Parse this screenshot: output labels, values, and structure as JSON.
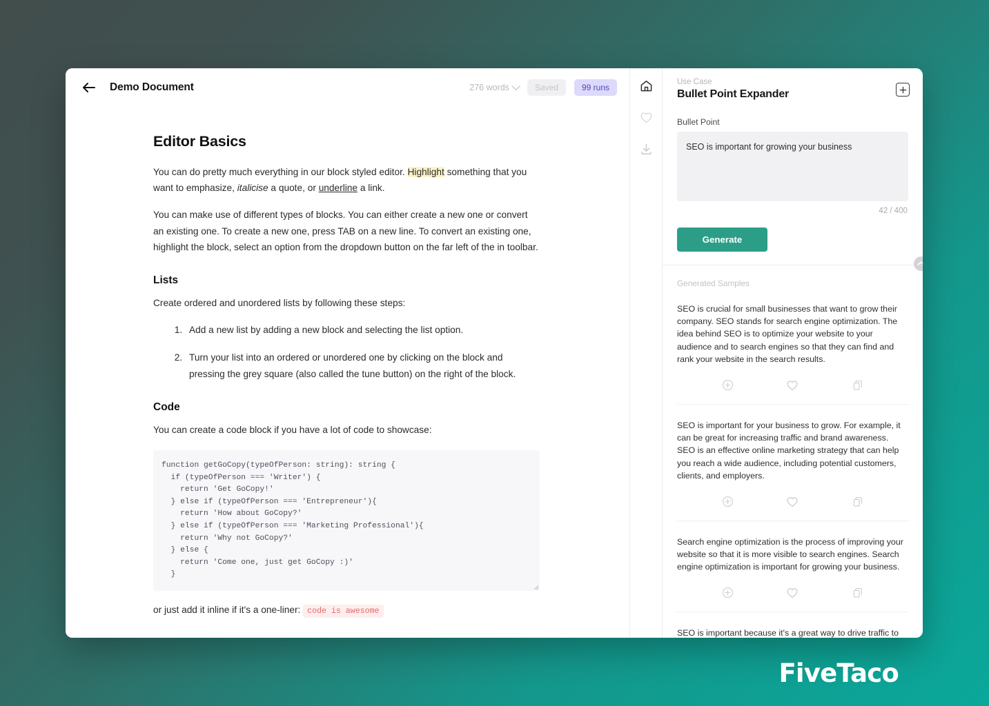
{
  "brand": {
    "logo": "FiveTaco",
    "accent_teal": "#0aa89a",
    "button_teal": "#2c9e87"
  },
  "editor": {
    "back_icon": "arrow-left-icon",
    "title": "Demo Document",
    "word_count": "276 words",
    "saved_badge": "Saved",
    "runs_badge": "99 runs",
    "sections": {
      "heading1": "Editor Basics",
      "para1_a": "You can do pretty much everything in our block styled editor. ",
      "para1_hl": "Highlight",
      "para1_b": " something that you want to emphasize, ",
      "para1_it": "italicise",
      "para1_c": " a quote, or ",
      "para1_ul": "underline",
      "para1_d": " a link.",
      "para2": "You can make use of different types of blocks. You can either create a new one or convert an existing one. To create a new one, press TAB on a new line. To convert an existing one, highlight the block, select an option from the dropdown button on the far left of the in toolbar.",
      "heading_lists": "Lists",
      "lists_intro": "Create ordered and unordered lists by following these steps:",
      "list_items": [
        "Add a new list by adding a new block and selecting the list option.",
        "Turn your list into an ordered or unordered one by clicking on the block and pressing the grey square (also called the tune button) on the right of the block."
      ],
      "heading_code": "Code",
      "code_intro": "You can create a code block if you have a lot of code to showcase:",
      "code_block": "function getGoCopy(typeOfPerson: string): string {\n  if (typeOfPerson === 'Writer') {\n    return 'Get GoCopy!'\n  } else if (typeOfPerson === 'Entrepreneur'){\n    return 'How about GoCopy?'\n  } else if (typeOfPerson === 'Marketing Professional'){\n    return 'Why not GoCopy?'\n  } else {\n    return 'Come one, just get GoCopy :)'\n  }",
      "inline_intro": "or just add it inline if it's a one-liner: ",
      "inline_code": "code is awesome"
    }
  },
  "rail": {
    "items": [
      {
        "icon": "home-icon",
        "active": true
      },
      {
        "icon": "heart-icon",
        "active": false
      },
      {
        "icon": "download-icon",
        "active": false
      }
    ]
  },
  "panel": {
    "use_case_label": "Use Case",
    "use_case_name": "Bullet Point Expander",
    "add_icon": "plus-square-icon",
    "field_label": "Bullet Point",
    "input_value": "SEO is important for growing your business",
    "char_count": "42 / 400",
    "generate_label": "Generate",
    "collapse_icon": "chevron-up-icon",
    "samples_label": "Generated Samples",
    "action_icons": [
      "plus-circle-icon",
      "heart-icon",
      "copy-icon"
    ],
    "samples": [
      "SEO is crucial for small businesses that want to grow their company. SEO stands for search engine optimization. The idea behind SEO is to optimize your website to your audience and to search engines so that they can find and rank your website in the search results.",
      "SEO is important for your business to grow. For example, it can be great for increasing traffic and brand awareness. SEO is an effective online marketing strategy that can help you reach a wide audience, including potential customers, clients, and employers.",
      "Search engine optimization is the process of improving your website so that it is more visible to search engines. Search engine optimization is important for growing your business.",
      "SEO is important because it's a great way to drive traffic to your"
    ]
  }
}
